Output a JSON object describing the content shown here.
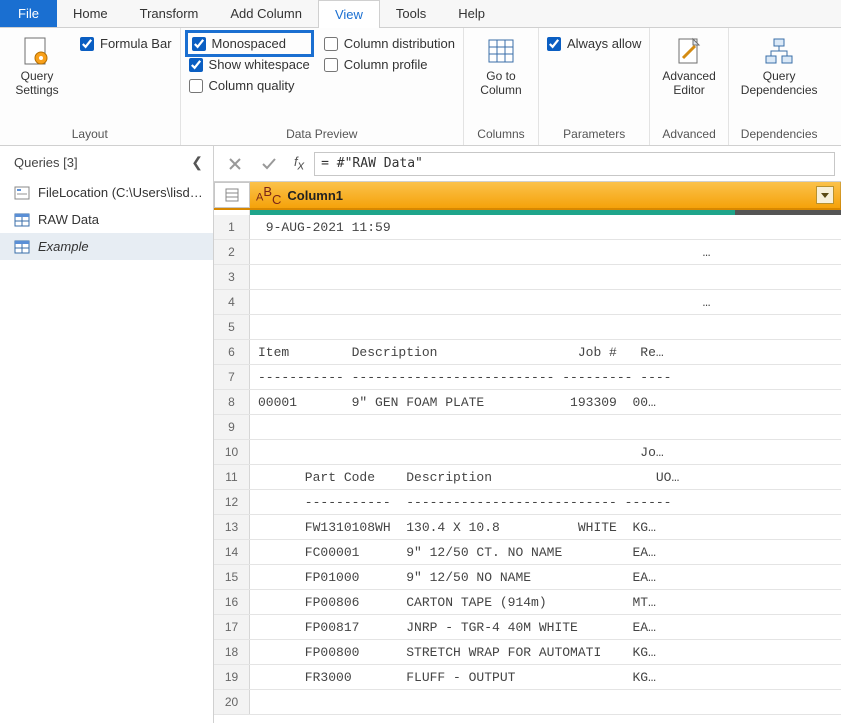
{
  "tabs": {
    "file": "File",
    "home": "Home",
    "transform": "Transform",
    "addcol": "Add Column",
    "view": "View",
    "tools": "Tools",
    "help": "Help"
  },
  "ribbon": {
    "layout": {
      "query_settings": "Query\nSettings",
      "formula_bar": "Formula Bar",
      "group": "Layout"
    },
    "preview": {
      "monospaced": "Monospaced",
      "show_ws": "Show whitespace",
      "col_quality": "Column quality",
      "col_dist": "Column distribution",
      "col_profile": "Column profile",
      "group": "Data Preview"
    },
    "columns": {
      "goto": "Go to\nColumn",
      "group": "Columns"
    },
    "parameters": {
      "always": "Always allow",
      "group": "Parameters"
    },
    "advanced": {
      "editor": "Advanced\nEditor",
      "group": "Advanced"
    },
    "deps": {
      "deps": "Query\nDependencies",
      "group": "Dependencies"
    }
  },
  "queries": {
    "header": "Queries [3]",
    "items": [
      {
        "name": "FileLocation (C:\\Users\\lisde…",
        "type": "param"
      },
      {
        "name": "RAW Data",
        "type": "table"
      },
      {
        "name": "Example",
        "type": "table"
      }
    ]
  },
  "formula": "= #\"RAW Data\"",
  "column_header": "Column1",
  "rows": [
    " 9-AUG-2021 11:59",
    "                                                         …",
    "",
    "                                                         …",
    "",
    "Item        Description                  Job #   Re…",
    "----------- -------------------------- --------- ----",
    "00001       9\" GEN FOAM PLATE           193309  00…",
    "",
    "                                                 Jo…",
    "      Part Code    Description                     UO…",
    "      -----------  --------------------------- ------",
    "      FW1310108WH  130.4 X 10.8          WHITE  KG…",
    "      FC00001      9\" 12/50 CT. NO NAME         EA…",
    "      FP01000      9\" 12/50 NO NAME             EA…",
    "      FP00806      CARTON TAPE (914m)           MT…",
    "      FP00817      JNRP - TGR-4 40M WHITE       EA…",
    "      FP00800      STRETCH WRAP FOR AUTOMATI    KG…",
    "      FR3000       FLUFF - OUTPUT               KG…",
    ""
  ]
}
